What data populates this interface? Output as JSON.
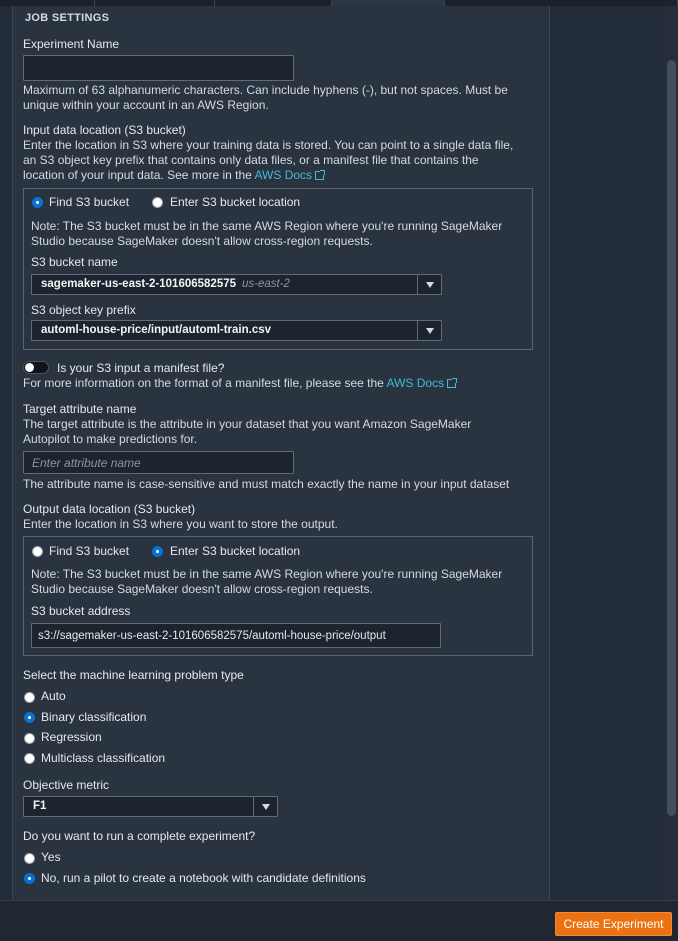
{
  "section_title": "JOB SETTINGS",
  "experiment_name": {
    "label": "Experiment Name",
    "value": "",
    "help_line1": "Maximum of 63 alphanumeric characters. Can include hyphens (-), but not spaces. Must be",
    "help_line2": "unique within your account in an AWS Region."
  },
  "input_location": {
    "label": "Input data location (S3 bucket)",
    "desc_line1": "Enter the location in S3 where your training data is stored. You can point to a single data file,",
    "desc_line2": "an S3 object key prefix that contains only data files, or a manifest file that contains the",
    "desc_line3": "location of your input data. See more in the",
    "docs_link": "AWS Docs",
    "radio_find": "Find S3 bucket",
    "radio_enter": "Enter S3 bucket location",
    "selected": "find",
    "note_line1": "Note: The S3 bucket must be in the same AWS Region where you're running SageMaker",
    "note_line2": "Studio because SageMaker doesn't allow cross-region requests.",
    "bucket_label": "S3 bucket name",
    "bucket_value": "sagemaker-us-east-2-101606582575",
    "bucket_region": "us-east-2",
    "prefix_label": "S3 object key prefix",
    "prefix_value": "automl-house-price/input/automl-train.csv"
  },
  "manifest": {
    "label": "Is your S3 input a manifest file?",
    "enabled": false,
    "help": "For more information on the format of a manifest file, please see the",
    "docs_link": "AWS Docs"
  },
  "target_attribute": {
    "label": "Target attribute name",
    "desc_line1": "The target attribute is the attribute in your dataset that you want Amazon SageMaker",
    "desc_line2": "Autopilot to make predictions for.",
    "placeholder": "Enter attribute name",
    "help": "The attribute name is case-sensitive and must match exactly the name in your input dataset"
  },
  "output_location": {
    "label": "Output data location (S3 bucket)",
    "desc": "Enter the location in S3 where you want to store the output.",
    "radio_find": "Find S3 bucket",
    "radio_enter": "Enter S3 bucket location",
    "selected": "enter",
    "note_line1": "Note: The S3 bucket must be in the same AWS Region where you're running SageMaker",
    "note_line2": "Studio because SageMaker doesn't allow cross-region requests.",
    "address_label": "S3 bucket address",
    "address_value": "s3://sagemaker-us-east-2-101606582575/automl-house-price/output"
  },
  "problem_type": {
    "label": "Select the machine learning problem type",
    "options": [
      "Auto",
      "Binary classification",
      "Regression",
      "Multiclass classification"
    ],
    "selected": "Binary classification"
  },
  "objective_metric": {
    "label": "Objective metric",
    "value": "F1"
  },
  "complete_experiment": {
    "label": "Do you want to run a complete experiment?",
    "options": [
      "Yes",
      "No, run a pilot to create a notebook with candidate definitions"
    ],
    "selected": "No, run a pilot to create a notebook with candidate definitions"
  },
  "footer": {
    "create_button": "Create Experiment"
  },
  "colors": {
    "panel_bg": "#2a3340",
    "accent_orange": "#ec7211",
    "radio_blue": "#0972d3",
    "link": "#44b9d6"
  }
}
